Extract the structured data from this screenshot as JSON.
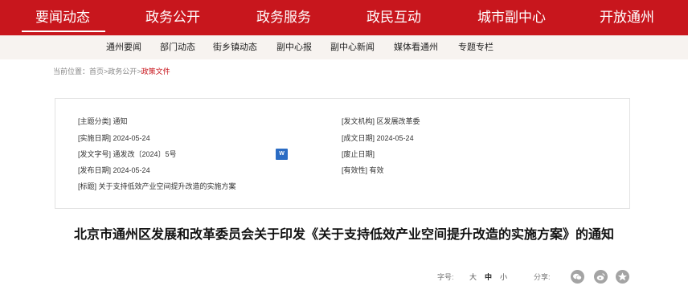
{
  "top_nav": {
    "items": [
      {
        "label": "要闻动态",
        "active": true
      },
      {
        "label": "政务公开",
        "active": false
      },
      {
        "label": "政务服务",
        "active": false
      },
      {
        "label": "政民互动",
        "active": false
      },
      {
        "label": "城市副中心",
        "active": false
      },
      {
        "label": "开放通州",
        "active": false
      }
    ],
    "accent_color": "#c8161d"
  },
  "sub_nav": {
    "items": [
      "通州要闻",
      "部门动态",
      "街乡镇动态",
      "副中心报",
      "副中心新闻",
      "媒体看通州",
      "专题专栏"
    ]
  },
  "breadcrumb": {
    "prefix": "当前位置：",
    "home": "首页",
    "sep1": ">",
    "level1": "政务公开",
    "sep2": ">",
    "current": "政策文件"
  },
  "meta": {
    "topic_key": "[主题分类]",
    "topic_value": "通知",
    "implement_date_key": "[实施日期]",
    "implement_date_value": "2024-05-24",
    "doc_number_key": "[发文字号]",
    "doc_number_value": "通发改〔2024〕5号",
    "publish_date_key": "[发布日期]",
    "publish_date_value": "2024-05-24",
    "subject_key": "[标题]",
    "subject_value": "关于支持低效产业空间提升改造的实施方案",
    "issuer_key": "[发文机构]",
    "issuer_value": "区发展改革委",
    "created_date_key": "[成文日期]",
    "created_date_value": "2024-05-24",
    "abolish_date_key": "[废止日期]",
    "abolish_date_value": "",
    "validity_key": "[有效性]",
    "validity_value": "有效",
    "doc_icon": "word-doc-icon"
  },
  "article": {
    "title": "北京市通州区发展和改革委员会关于印发《关于支持低效产业空间提升改造的实施方案》的通知"
  },
  "toolbar": {
    "font_size_label": "字号:",
    "font_large": "大",
    "font_medium": "中",
    "font_small": "小",
    "share_label": "分享:",
    "share_icons": [
      "wechat-icon",
      "weibo-icon",
      "qq-zone-icon"
    ]
  }
}
